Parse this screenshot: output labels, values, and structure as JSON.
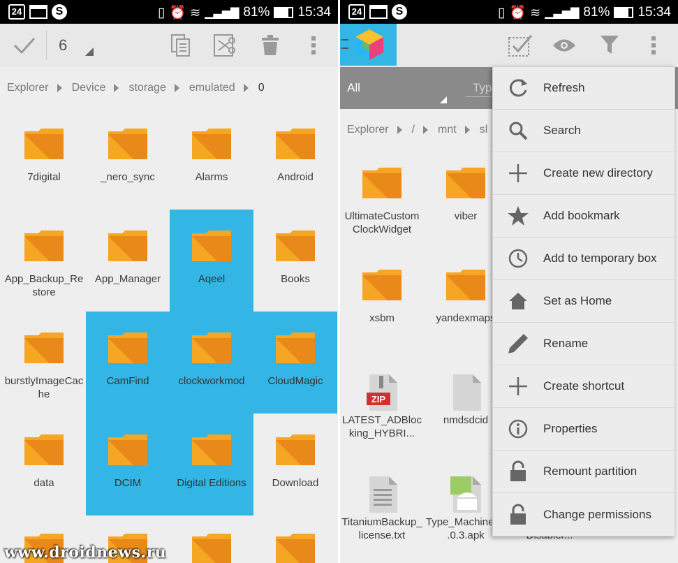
{
  "status_bar": {
    "date_badge": "24",
    "battery": "81%",
    "time": "15:34"
  },
  "left_panel": {
    "selection_count": "6",
    "breadcrumb": [
      "Explorer",
      "Device",
      "storage",
      "emulated",
      "0"
    ],
    "folders": [
      {
        "name": "7digital",
        "selected": false
      },
      {
        "name": "_nero_sync",
        "selected": false
      },
      {
        "name": "Alarms",
        "selected": false
      },
      {
        "name": "Android",
        "selected": false
      },
      {
        "name": "App_Backup_Restore",
        "selected": false
      },
      {
        "name": "App_Manager",
        "selected": false
      },
      {
        "name": "Aqeel",
        "selected": true
      },
      {
        "name": "Books",
        "selected": false
      },
      {
        "name": "burstlyImageCache",
        "selected": false
      },
      {
        "name": "CamFind",
        "selected": true
      },
      {
        "name": "clockworkmod",
        "selected": true
      },
      {
        "name": "CloudMagic",
        "selected": true
      },
      {
        "name": "data",
        "selected": false
      },
      {
        "name": "DCIM",
        "selected": true
      },
      {
        "name": "Digital Editions",
        "selected": true
      },
      {
        "name": "Download",
        "selected": false
      }
    ]
  },
  "right_panel": {
    "filter_label": "All",
    "type_label": "Typ",
    "breadcrumb": [
      "Explorer",
      "/",
      "mnt",
      "sl"
    ],
    "items": [
      {
        "name": "UltimateCustomClockWidget",
        "kind": "folder"
      },
      {
        "name": "viber",
        "kind": "folder"
      },
      {
        "name": "xsbm",
        "kind": "folder"
      },
      {
        "name": "yandexmaps",
        "kind": "folder"
      },
      {
        "name": "LATEST_ADBlocking_HYBRI...",
        "kind": "zip"
      },
      {
        "name": "nmdsdcid",
        "kind": "file"
      },
      {
        "name": "TitaniumBackup_license.txt",
        "kind": "txt"
      },
      {
        "name": "Type_Machine_1.0.3.apk",
        "kind": "apk"
      },
      {
        "name": "xposed-Disabler...",
        "kind": "file"
      }
    ],
    "menu": [
      {
        "label": "Refresh",
        "icon": "refresh-icon"
      },
      {
        "label": "Search",
        "icon": "search-icon"
      },
      {
        "label": "Create new directory",
        "icon": "plus-icon"
      },
      {
        "label": "Add bookmark",
        "icon": "star-icon"
      },
      {
        "label": "Add to temporary box",
        "icon": "clock-icon"
      },
      {
        "label": "Set as Home",
        "icon": "home-icon"
      },
      {
        "label": "Rename",
        "icon": "pencil-icon"
      },
      {
        "label": "Create shortcut",
        "icon": "plus-icon"
      },
      {
        "label": "Properties",
        "icon": "info-icon"
      },
      {
        "label": "Remount partition",
        "icon": "lock-icon"
      },
      {
        "label": "Change permissions",
        "icon": "lock-icon"
      }
    ]
  },
  "watermark": "www.droidnews.ru",
  "colors": {
    "selection": "#33b5e5",
    "folder": "#f5a623",
    "folder_dark": "#e8891a"
  }
}
